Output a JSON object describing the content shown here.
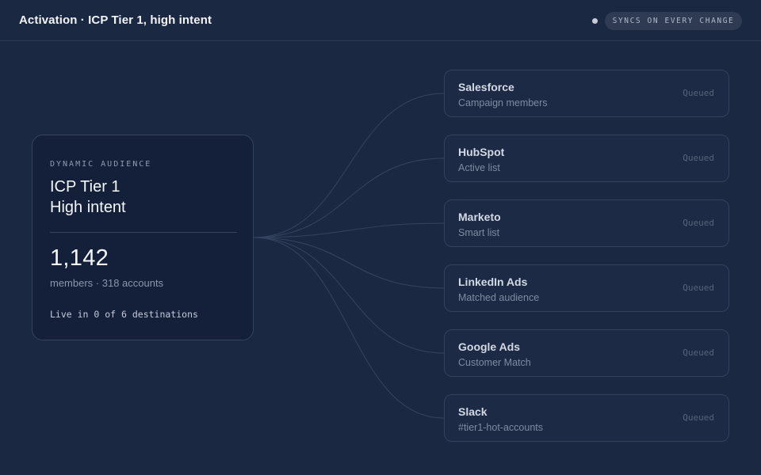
{
  "header": {
    "title": "Activation · ICP Tier 1, high intent",
    "sync_label": "SYNCS ON EVERY CHANGE"
  },
  "audience": {
    "label": "DYNAMIC AUDIENCE",
    "name_line1": "ICP Tier 1",
    "name_line2": "High intent",
    "count": "1,142",
    "subtitle": "members · 318 accounts",
    "live_status": "Live in 0 of 6 destinations"
  },
  "destinations": [
    {
      "name": "Salesforce",
      "type": "Campaign members",
      "status": "Queued"
    },
    {
      "name": "HubSpot",
      "type": "Active list",
      "status": "Queued"
    },
    {
      "name": "Marketo",
      "type": "Smart list",
      "status": "Queued"
    },
    {
      "name": "LinkedIn Ads",
      "type": "Matched audience",
      "status": "Queued"
    },
    {
      "name": "Google Ads",
      "type": "Customer Match",
      "status": "Queued"
    },
    {
      "name": "Slack",
      "type": "#tier1-hot-accounts",
      "status": "Queued"
    }
  ],
  "colors": {
    "background": "#1b2842",
    "card": "#14203a",
    "connector": "#344560"
  }
}
